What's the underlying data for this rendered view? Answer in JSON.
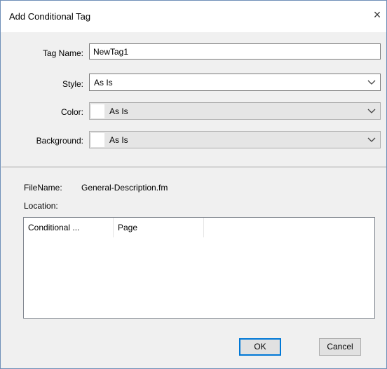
{
  "dialog": {
    "title": "Add Conditional Tag",
    "close_glyph": "×"
  },
  "form": {
    "tag_name_label": "Tag Name:",
    "tag_name_value": "NewTag1",
    "style_label": "Style:",
    "style_value": "As Is",
    "color_label": "Color:",
    "color_value": "As Is",
    "background_label": "Background:",
    "background_value": "As Is"
  },
  "info": {
    "filename_label": "FileName:",
    "filename_value": "General-Description.fm",
    "location_label": "Location:"
  },
  "list": {
    "columns": [
      "Conditional ...",
      "Page"
    ]
  },
  "buttons": {
    "ok": "OK",
    "cancel": "Cancel"
  },
  "icons": {
    "close": "close-icon",
    "dropdown": "chevron-down-icon"
  },
  "colors": {
    "accent": "#0078d7",
    "dialog_bg": "#f0f0f0",
    "border": "#6f8fb8"
  }
}
